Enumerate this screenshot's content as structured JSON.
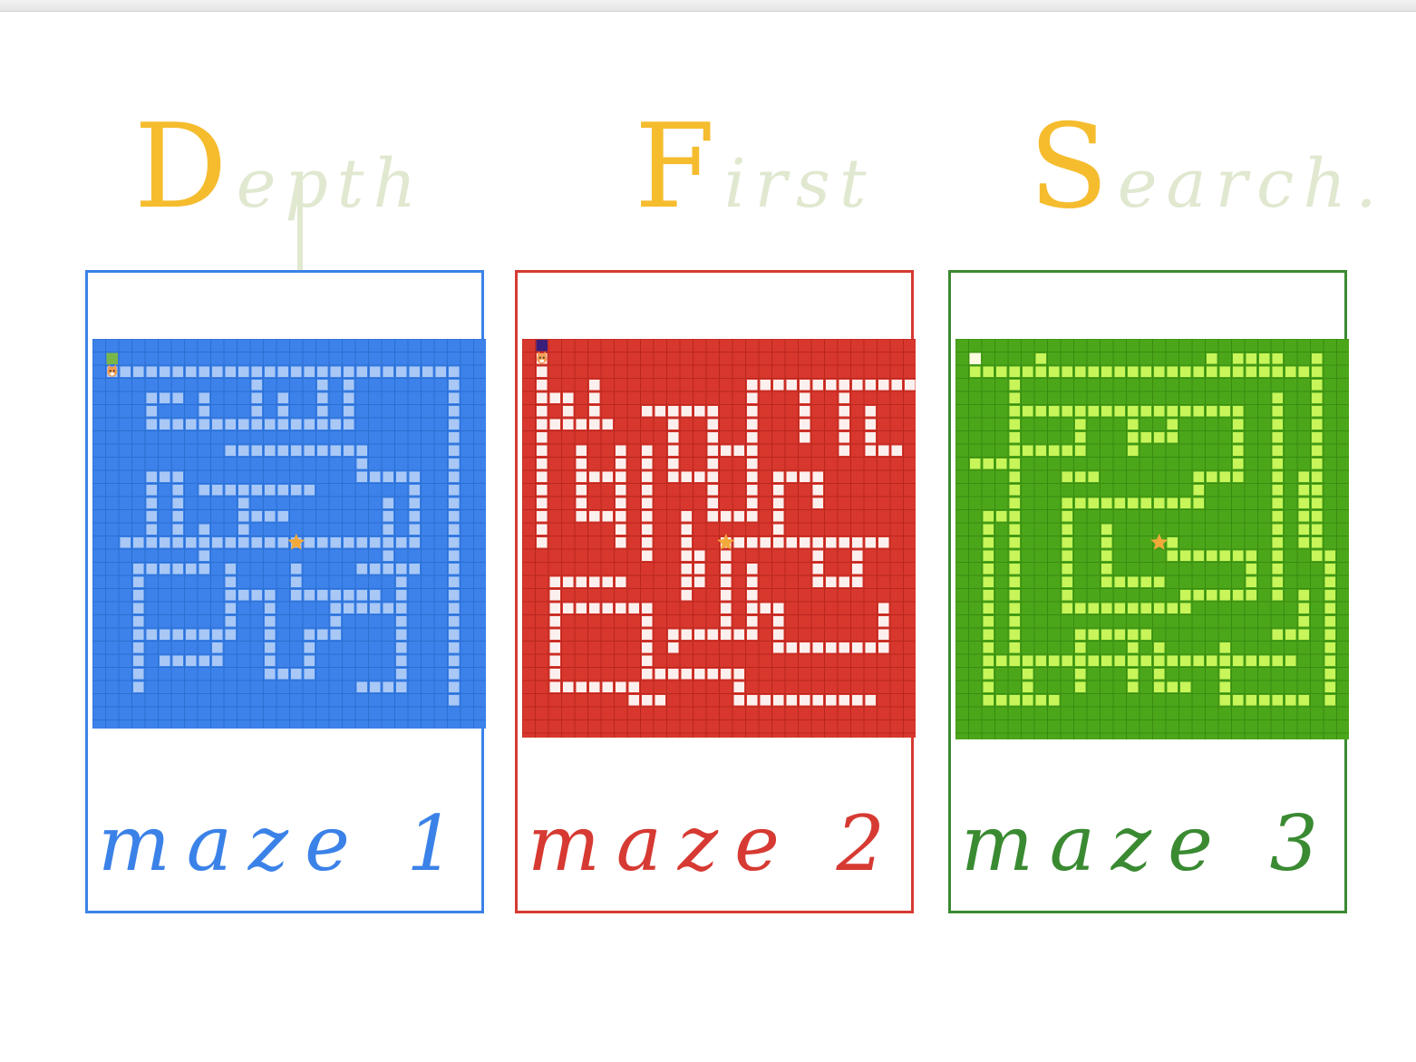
{
  "title": {
    "words": [
      {
        "initial": "D",
        "rest": "epth"
      },
      {
        "initial": "F",
        "rest": "irst"
      },
      {
        "initial": "S",
        "rest": "earch."
      }
    ],
    "initial_color": "#f5bc2e",
    "rest_color": "#e0e8d0"
  },
  "mazes": [
    {
      "caption": "maze 1",
      "frame_color": "#3b82e8",
      "bg": "#3c82ea",
      "grid": "#2b6fd1",
      "path": "#a9c8f6",
      "start_color": "#79b64a",
      "start_icon": "cat-icon",
      "goal_icon": "star-icon"
    },
    {
      "caption": "maze 2",
      "frame_color": "#d63a32",
      "bg": "#d8372d",
      "grid": "#b8271f",
      "path": "#fbf0ee",
      "start_color": "#3a1f7a",
      "start_icon": "cat-icon",
      "goal_icon": "star-icon"
    },
    {
      "caption": "maze 3",
      "frame_color": "#3a8a32",
      "bg": "#4ca61a",
      "grid": "#3a8c10",
      "path": "#c8f55a",
      "start_color": "#fffbe0",
      "start_icon": "",
      "goal_icon": "star-icon"
    }
  ],
  "colors": {
    "star": "#f3a93a",
    "cat": "#f29b50"
  }
}
